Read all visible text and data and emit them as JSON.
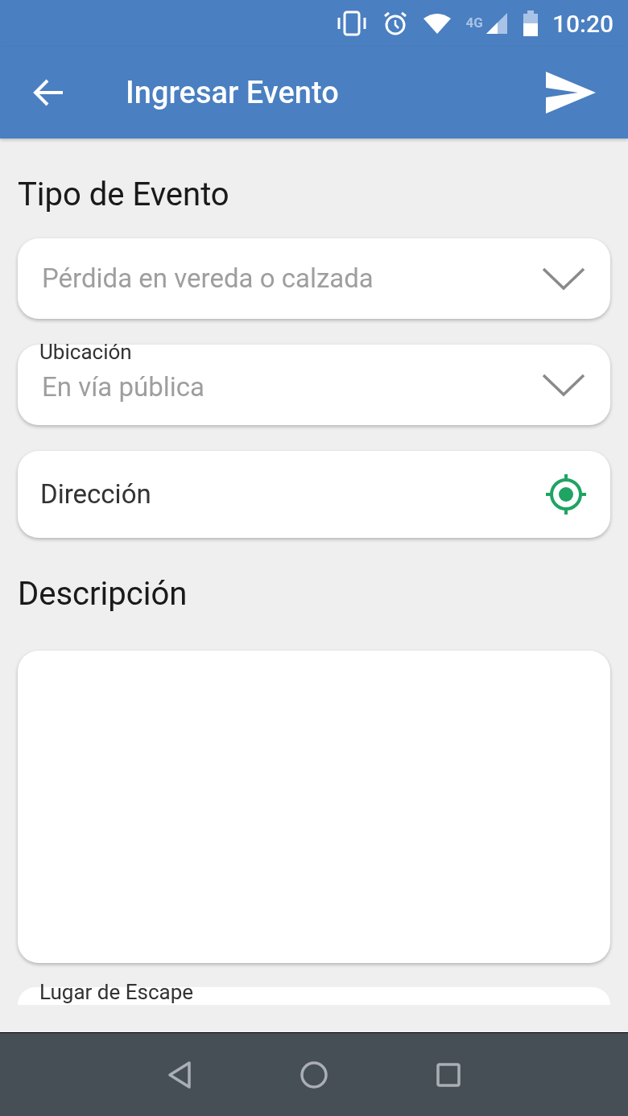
{
  "status_bar": {
    "network": "4G",
    "time": "10:20"
  },
  "app_bar": {
    "title": "Ingresar Evento"
  },
  "form": [
    {
      "kind": "heading",
      "text": "Tipo de Evento"
    },
    {
      "kind": "select",
      "value": "Pérdida en vereda o calzada"
    },
    {
      "kind": "select",
      "label": "Ubicación",
      "value": "En vía pública"
    },
    {
      "kind": "location",
      "placeholder": "Dirección"
    },
    {
      "kind": "heading",
      "text": "Descripción"
    },
    {
      "kind": "textarea"
    },
    {
      "kind": "partial",
      "label": "Lugar de Escape"
    }
  ]
}
